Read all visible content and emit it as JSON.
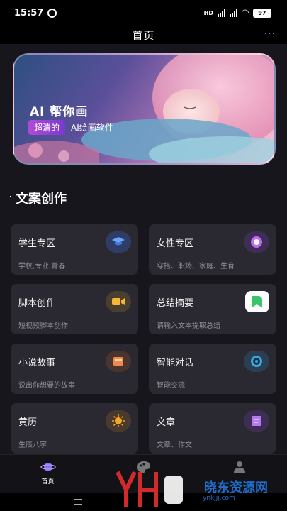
{
  "status_bar": {
    "time": "15:57",
    "battery": "97",
    "network_label": "HD"
  },
  "header": {
    "title": "首页"
  },
  "banner": {
    "title": "AI 帮你画",
    "tag": "超清的",
    "subtitle": "AI绘画软件"
  },
  "section": {
    "title": "文案创作"
  },
  "cards": [
    {
      "title": "学生专区",
      "desc": "学校,专业,青春",
      "icon": "graduation-cap-icon",
      "icon_bg": "#2f3d66"
    },
    {
      "title": "女性专区",
      "desc": "穿搭、职场、家庭、生育",
      "icon": "circle-icon",
      "icon_bg": "#3e2d55"
    },
    {
      "title": "脚本创作",
      "desc": "短视频脚本创作",
      "icon": "video-camera-icon",
      "icon_bg": "#4a3f2e"
    },
    {
      "title": "总结摘要",
      "desc": "请输入文本提取总结",
      "icon": "summary-icon",
      "icon_bg": "#ffffff"
    },
    {
      "title": "小说故事",
      "desc": "说出你想要的故事",
      "icon": "book-icon",
      "icon_bg": "#4a352e"
    },
    {
      "title": "智能对话",
      "desc": "智能交流",
      "icon": "chat-bubble-icon",
      "icon_bg": "#2b3f52"
    },
    {
      "title": "黄历",
      "desc": "生辰八字",
      "icon": "sun-icon",
      "icon_bg": "#4a3a2e"
    },
    {
      "title": "文章",
      "desc": "文章、作文",
      "icon": "article-icon",
      "icon_bg": "#3e2d55"
    }
  ],
  "bottom_nav": {
    "home_label": "首页"
  },
  "watermark": {
    "text": "晓东资源网",
    "url": "ynkjjj.com"
  }
}
